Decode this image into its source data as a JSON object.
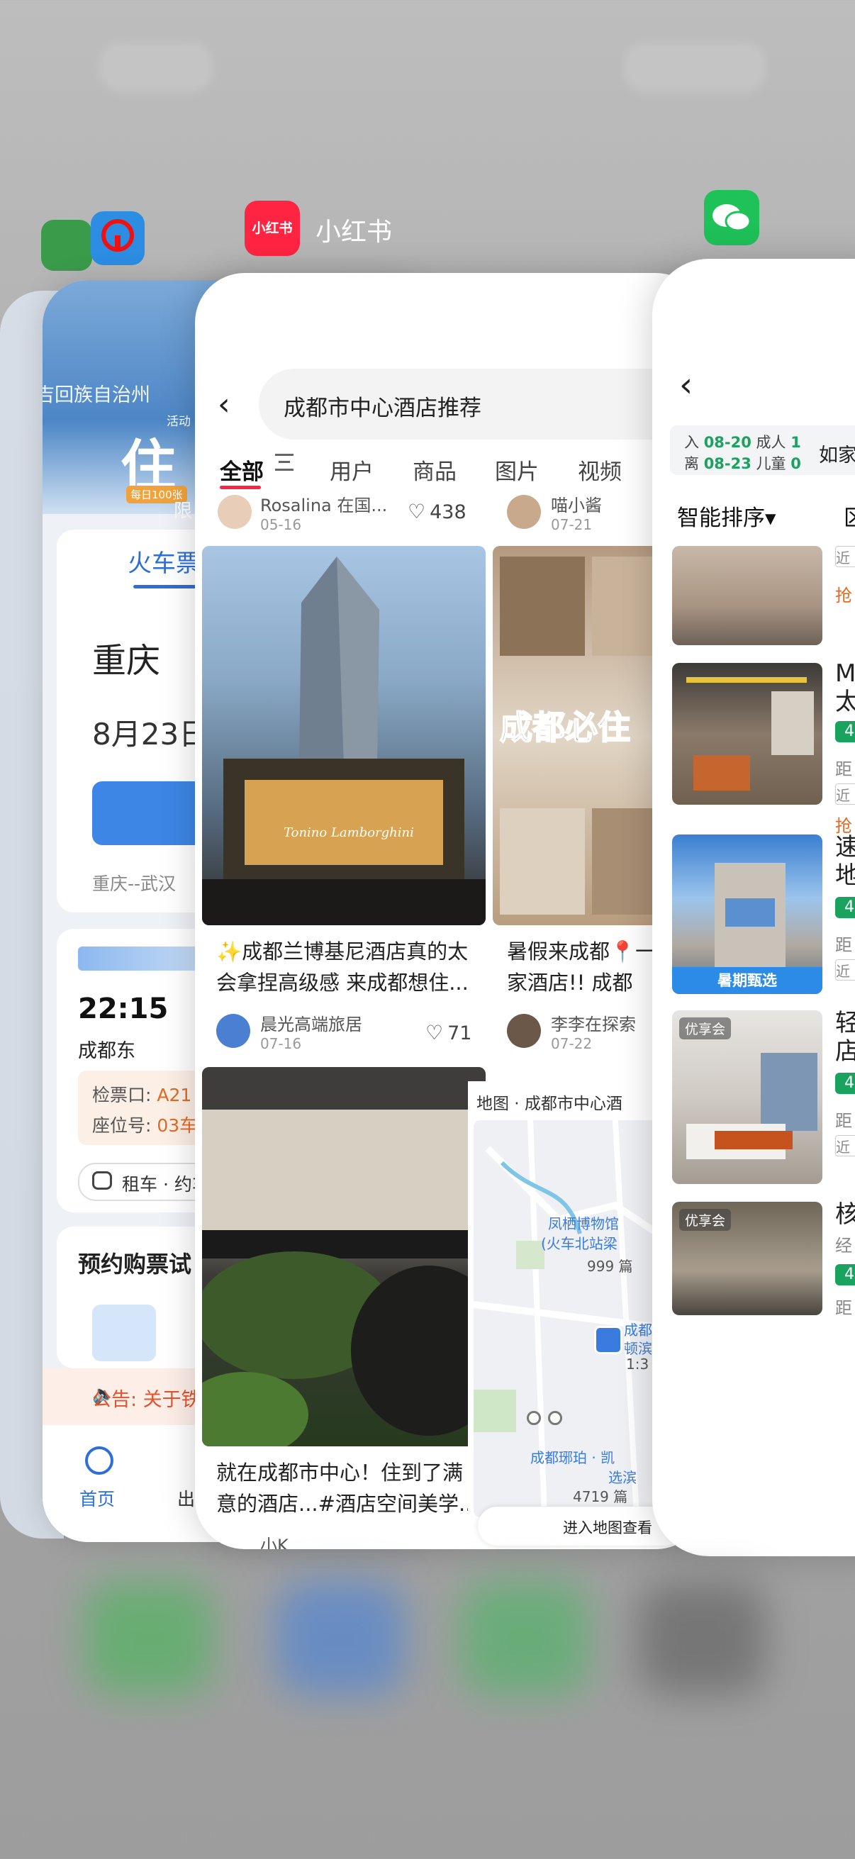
{
  "apps": {
    "train_app": {
      "label": ""
    },
    "xhs_app": {
      "label": "小红书",
      "icon_text": "小红书"
    },
    "wechat_app": {
      "label": ""
    }
  },
  "train_card": {
    "region": "吉回族自治州",
    "banner_activity": "活动",
    "banner_word": "住",
    "banner_tag": "每日100张",
    "banner_limit": "限",
    "tab": "火车票",
    "from_city": "重庆",
    "date": "8月23日",
    "route": "重庆--武汉",
    "ticket": {
      "time": "22:15",
      "station": "成都东",
      "gate_label": "检票口:",
      "gate_value": "A21",
      "seat_label": "座位号:",
      "seat_value": "03车"
    },
    "taxi_label": "租车 · 约车",
    "reserve_title": "预约购票试",
    "notice": "公告: 关于铁",
    "nav_home": "首页",
    "nav_second": "出"
  },
  "xhs_card": {
    "search_query": "成都市中心酒店推荐",
    "tabs": [
      "全部",
      "用户",
      "商品",
      "图片",
      "视频"
    ],
    "top_row": [
      {
        "author": "Rosalina 在国...",
        "date": "05-16",
        "likes": "438"
      },
      {
        "author": "喵小酱",
        "date": "07-21",
        "likes": ""
      }
    ],
    "posts": [
      {
        "caption": "✨成都兰博基尼酒店真的太会拿捏高级感 来成都想住...",
        "author": "晨光高端旅居",
        "date": "07-16",
        "likes": "71",
        "img_text": "Tonino Lamborghini"
      },
      {
        "caption": "暑假来成都📍一几家酒店!! 成都",
        "author": "李李在探索",
        "date": "07-22",
        "likes": "",
        "img_text": "成都必住"
      },
      {
        "caption": "就在成都市中心！住到了满意的酒店...#酒店空间美学...",
        "author": "小K",
        "date": "",
        "likes": "",
        "img_text": ""
      }
    ],
    "map": {
      "title": "地图 · 成都市中心酒",
      "poi1": "凤栖博物馆",
      "poi1b": "(火车北站梁",
      "count1": "999 篇",
      "poi2": "成都",
      "poi2b": "顿滨",
      "ratio": "1:3",
      "poi3": "成都琊珀 · 凯",
      "poi3b": "选滨",
      "count2": "4719 篇",
      "button": "进入地图查看"
    }
  },
  "hotel_card": {
    "checkin_label": "入",
    "checkin": "08-20",
    "checkout_label": "离",
    "checkout": "08-23",
    "adults_label": "成人",
    "adults": "1",
    "kids_label": "儿童",
    "kids": "0",
    "chain_filter": "如家",
    "sort": "智能排序▾",
    "sort2": "区",
    "items": [
      {
        "name": "",
        "score": "",
        "dist": "近",
        "deal": "抢"
      },
      {
        "name": "M\n太",
        "score": "4",
        "dist": "距",
        "chip": "近",
        "deal": "抢"
      },
      {
        "name": "速\n地",
        "score": "4",
        "dist": "距",
        "chip": "近",
        "promo": "暑期甄选"
      },
      {
        "name": "轻\n店",
        "score": "4",
        "dist": "距",
        "chip": "近",
        "badge": "优享会"
      },
      {
        "name": "核",
        "sub": "经",
        "score": "4",
        "dist": "距",
        "badge": "优享会"
      }
    ]
  },
  "colors": {
    "xhs_red": "#ff2442",
    "wechat_green": "#1fc159",
    "train_blue": "#2d6fd6",
    "score_green": "#19a35e"
  }
}
